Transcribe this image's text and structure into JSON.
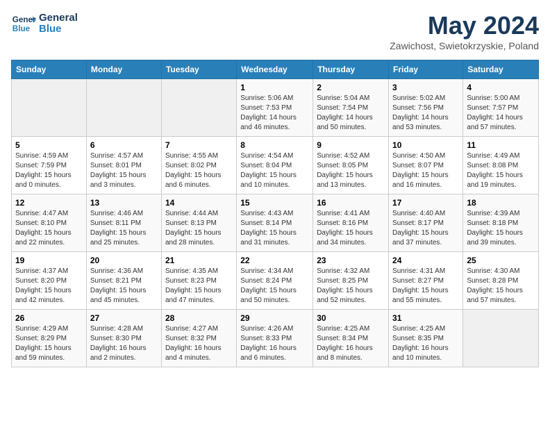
{
  "header": {
    "logo_general": "General",
    "logo_blue": "Blue",
    "month_title": "May 2024",
    "subtitle": "Zawichost, Swietokrzyskie, Poland"
  },
  "weekdays": [
    "Sunday",
    "Monday",
    "Tuesday",
    "Wednesday",
    "Thursday",
    "Friday",
    "Saturday"
  ],
  "weeks": [
    [
      {
        "day": "",
        "sunrise": "",
        "sunset": "",
        "daylight": ""
      },
      {
        "day": "",
        "sunrise": "",
        "sunset": "",
        "daylight": ""
      },
      {
        "day": "",
        "sunrise": "",
        "sunset": "",
        "daylight": ""
      },
      {
        "day": "1",
        "sunrise": "Sunrise: 5:06 AM",
        "sunset": "Sunset: 7:53 PM",
        "daylight": "Daylight: 14 hours and 46 minutes."
      },
      {
        "day": "2",
        "sunrise": "Sunrise: 5:04 AM",
        "sunset": "Sunset: 7:54 PM",
        "daylight": "Daylight: 14 hours and 50 minutes."
      },
      {
        "day": "3",
        "sunrise": "Sunrise: 5:02 AM",
        "sunset": "Sunset: 7:56 PM",
        "daylight": "Daylight: 14 hours and 53 minutes."
      },
      {
        "day": "4",
        "sunrise": "Sunrise: 5:00 AM",
        "sunset": "Sunset: 7:57 PM",
        "daylight": "Daylight: 14 hours and 57 minutes."
      }
    ],
    [
      {
        "day": "5",
        "sunrise": "Sunrise: 4:59 AM",
        "sunset": "Sunset: 7:59 PM",
        "daylight": "Daylight: 15 hours and 0 minutes."
      },
      {
        "day": "6",
        "sunrise": "Sunrise: 4:57 AM",
        "sunset": "Sunset: 8:01 PM",
        "daylight": "Daylight: 15 hours and 3 minutes."
      },
      {
        "day": "7",
        "sunrise": "Sunrise: 4:55 AM",
        "sunset": "Sunset: 8:02 PM",
        "daylight": "Daylight: 15 hours and 6 minutes."
      },
      {
        "day": "8",
        "sunrise": "Sunrise: 4:54 AM",
        "sunset": "Sunset: 8:04 PM",
        "daylight": "Daylight: 15 hours and 10 minutes."
      },
      {
        "day": "9",
        "sunrise": "Sunrise: 4:52 AM",
        "sunset": "Sunset: 8:05 PM",
        "daylight": "Daylight: 15 hours and 13 minutes."
      },
      {
        "day": "10",
        "sunrise": "Sunrise: 4:50 AM",
        "sunset": "Sunset: 8:07 PM",
        "daylight": "Daylight: 15 hours and 16 minutes."
      },
      {
        "day": "11",
        "sunrise": "Sunrise: 4:49 AM",
        "sunset": "Sunset: 8:08 PM",
        "daylight": "Daylight: 15 hours and 19 minutes."
      }
    ],
    [
      {
        "day": "12",
        "sunrise": "Sunrise: 4:47 AM",
        "sunset": "Sunset: 8:10 PM",
        "daylight": "Daylight: 15 hours and 22 minutes."
      },
      {
        "day": "13",
        "sunrise": "Sunrise: 4:46 AM",
        "sunset": "Sunset: 8:11 PM",
        "daylight": "Daylight: 15 hours and 25 minutes."
      },
      {
        "day": "14",
        "sunrise": "Sunrise: 4:44 AM",
        "sunset": "Sunset: 8:13 PM",
        "daylight": "Daylight: 15 hours and 28 minutes."
      },
      {
        "day": "15",
        "sunrise": "Sunrise: 4:43 AM",
        "sunset": "Sunset: 8:14 PM",
        "daylight": "Daylight: 15 hours and 31 minutes."
      },
      {
        "day": "16",
        "sunrise": "Sunrise: 4:41 AM",
        "sunset": "Sunset: 8:16 PM",
        "daylight": "Daylight: 15 hours and 34 minutes."
      },
      {
        "day": "17",
        "sunrise": "Sunrise: 4:40 AM",
        "sunset": "Sunset: 8:17 PM",
        "daylight": "Daylight: 15 hours and 37 minutes."
      },
      {
        "day": "18",
        "sunrise": "Sunrise: 4:39 AM",
        "sunset": "Sunset: 8:18 PM",
        "daylight": "Daylight: 15 hours and 39 minutes."
      }
    ],
    [
      {
        "day": "19",
        "sunrise": "Sunrise: 4:37 AM",
        "sunset": "Sunset: 8:20 PM",
        "daylight": "Daylight: 15 hours and 42 minutes."
      },
      {
        "day": "20",
        "sunrise": "Sunrise: 4:36 AM",
        "sunset": "Sunset: 8:21 PM",
        "daylight": "Daylight: 15 hours and 45 minutes."
      },
      {
        "day": "21",
        "sunrise": "Sunrise: 4:35 AM",
        "sunset": "Sunset: 8:23 PM",
        "daylight": "Daylight: 15 hours and 47 minutes."
      },
      {
        "day": "22",
        "sunrise": "Sunrise: 4:34 AM",
        "sunset": "Sunset: 8:24 PM",
        "daylight": "Daylight: 15 hours and 50 minutes."
      },
      {
        "day": "23",
        "sunrise": "Sunrise: 4:32 AM",
        "sunset": "Sunset: 8:25 PM",
        "daylight": "Daylight: 15 hours and 52 minutes."
      },
      {
        "day": "24",
        "sunrise": "Sunrise: 4:31 AM",
        "sunset": "Sunset: 8:27 PM",
        "daylight": "Daylight: 15 hours and 55 minutes."
      },
      {
        "day": "25",
        "sunrise": "Sunrise: 4:30 AM",
        "sunset": "Sunset: 8:28 PM",
        "daylight": "Daylight: 15 hours and 57 minutes."
      }
    ],
    [
      {
        "day": "26",
        "sunrise": "Sunrise: 4:29 AM",
        "sunset": "Sunset: 8:29 PM",
        "daylight": "Daylight: 15 hours and 59 minutes."
      },
      {
        "day": "27",
        "sunrise": "Sunrise: 4:28 AM",
        "sunset": "Sunset: 8:30 PM",
        "daylight": "Daylight: 16 hours and 2 minutes."
      },
      {
        "day": "28",
        "sunrise": "Sunrise: 4:27 AM",
        "sunset": "Sunset: 8:32 PM",
        "daylight": "Daylight: 16 hours and 4 minutes."
      },
      {
        "day": "29",
        "sunrise": "Sunrise: 4:26 AM",
        "sunset": "Sunset: 8:33 PM",
        "daylight": "Daylight: 16 hours and 6 minutes."
      },
      {
        "day": "30",
        "sunrise": "Sunrise: 4:25 AM",
        "sunset": "Sunset: 8:34 PM",
        "daylight": "Daylight: 16 hours and 8 minutes."
      },
      {
        "day": "31",
        "sunrise": "Sunrise: 4:25 AM",
        "sunset": "Sunset: 8:35 PM",
        "daylight": "Daylight: 16 hours and 10 minutes."
      },
      {
        "day": "",
        "sunrise": "",
        "sunset": "",
        "daylight": ""
      }
    ]
  ]
}
